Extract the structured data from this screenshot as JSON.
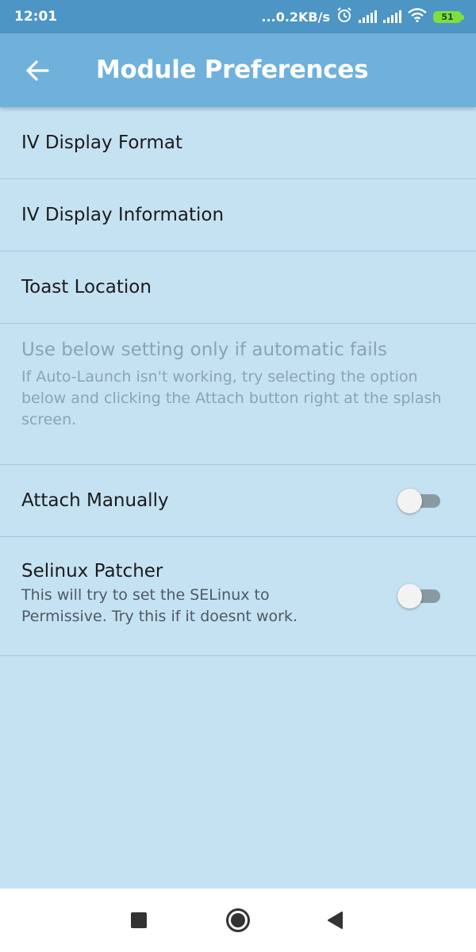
{
  "status_bar": {
    "time": "12:01",
    "net_speed": "...0.2KB/s",
    "battery_level": "51",
    "icons": [
      "alarm-icon",
      "signal-icon",
      "signal-icon",
      "wifi-icon",
      "battery-icon"
    ]
  },
  "app_bar": {
    "title": "Module Preferences",
    "back_icon": "arrow-left-icon"
  },
  "preferences": {
    "display_format": {
      "title": "IV Display Format"
    },
    "display_information": {
      "title": "IV Display Information"
    },
    "toast_location": {
      "title": "Toast Location"
    },
    "category": {
      "title": "Use below setting only if automatic fails",
      "summary": "If Auto-Launch isn't working, try selecting the option below and clicking the Attach button right at the splash screen."
    },
    "attach_manually": {
      "title": "Attach Manually",
      "enabled": false
    },
    "selinux_patcher": {
      "title": "Selinux Patcher",
      "summary": "This will try to set the SELinux to Permissive. Try this if it doesnt work.",
      "enabled": false
    }
  },
  "nav_bar": {
    "icons": [
      "square-recents-icon",
      "circle-home-icon",
      "triangle-back-icon"
    ]
  },
  "colors": {
    "status_bar": "#4c95c5",
    "app_bar": "#6fb1db",
    "background": "#c5e2f3",
    "divider": "#a9c6d9",
    "battery": "#7cdf3f"
  }
}
